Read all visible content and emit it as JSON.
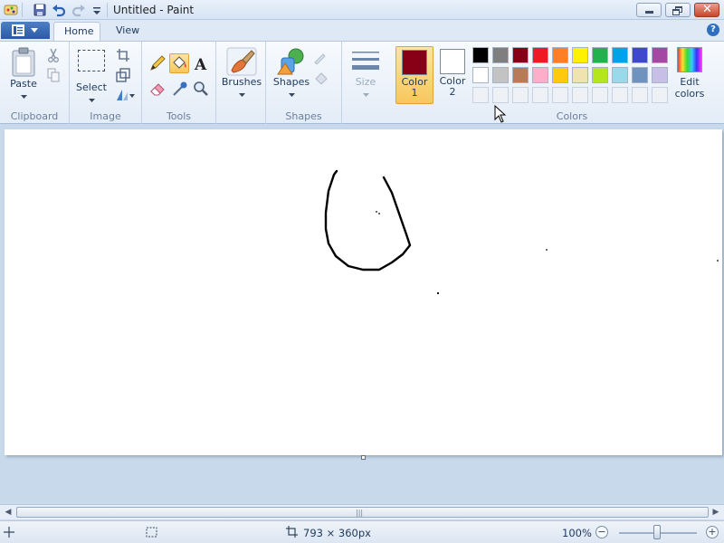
{
  "window": {
    "title": "Untitled - Paint"
  },
  "tabs": [
    {
      "label": "Home",
      "active": true
    },
    {
      "label": "View",
      "active": false
    }
  ],
  "ribbon": {
    "clipboard": {
      "group_label": "Clipboard",
      "paste_label": "Paste"
    },
    "image": {
      "group_label": "Image",
      "select_label": "Select"
    },
    "tools": {
      "group_label": "Tools"
    },
    "brushes": {
      "label": "Brushes"
    },
    "shapes": {
      "group_label": "Shapes",
      "label": "Shapes"
    },
    "size": {
      "label": "Size"
    },
    "colors": {
      "group_label": "Colors",
      "color1": {
        "label_line1": "Color",
        "label_line2": "1",
        "value": "#880015"
      },
      "color2": {
        "label_line1": "Color",
        "label_line2": "2",
        "value": "#ffffff"
      },
      "edit_label_line1": "Edit",
      "edit_label_line2": "colors",
      "palette_row1": [
        "#000000",
        "#7f7f7f",
        "#880015",
        "#ed1c24",
        "#ff7f27",
        "#fff200",
        "#22b14c",
        "#00a2e8",
        "#3f48cc",
        "#a349a4"
      ],
      "palette_row2": [
        "#ffffff",
        "#c3c3c3",
        "#b97a57",
        "#ffaec9",
        "#ffc90e",
        "#efe4b0",
        "#b5e61d",
        "#99d9ea",
        "#7092be",
        "#c8bfe7"
      ]
    }
  },
  "status": {
    "dimensions": "793 × 360px",
    "zoom": "100%"
  },
  "colors": {
    "accent": "#2a5aa6",
    "ribbon_bg": "#e3ecf7",
    "workspace_bg": "#c9d9ec"
  }
}
